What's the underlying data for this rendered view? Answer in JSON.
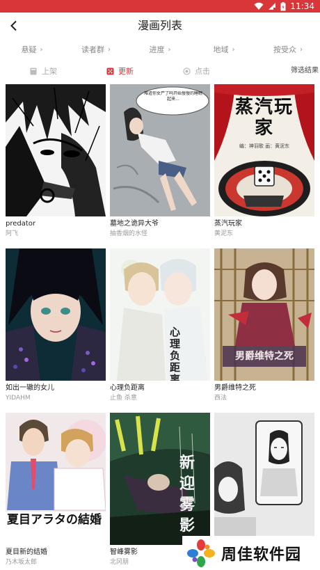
{
  "status_bar": {
    "time": "11:34",
    "color": "#d9363a"
  },
  "header": {
    "title": "漫画列表",
    "back_icon": "chevron-left-icon"
  },
  "filters": [
    {
      "label": "悬疑"
    },
    {
      "label": "读者群"
    },
    {
      "label": "进度"
    },
    {
      "label": "地域"
    },
    {
      "label": "按受众"
    }
  ],
  "sort_tabs": [
    {
      "label": "上架",
      "icon": "shelf-icon",
      "active": false
    },
    {
      "label": "更新",
      "icon": "update-icon",
      "active": true
    },
    {
      "label": "点击",
      "icon": "click-icon",
      "active": false
    }
  ],
  "screen_label": "筛选结果",
  "comics": [
    {
      "title": "predator",
      "author": "阿飞"
    },
    {
      "title": "墓地之诡异大爷",
      "author": "抽香烟的水怪",
      "bubble": "难道你女尸了吗开始慢慢的睡眠起来..."
    },
    {
      "title": "蒸汽玩家",
      "author": "黄泥东",
      "cover_title": "蒸汽玩家",
      "cover_sub": "编：神羽歌  画：黄泥东"
    },
    {
      "title": "如出一辙的女儿",
      "author": "YIDAHM"
    },
    {
      "title": "心理负距离",
      "author": "止鱼 杀意",
      "cover_title": "心理负距离"
    },
    {
      "title": "男爵维特之死",
      "author": "西法",
      "cover_title": "男爵维特之死"
    },
    {
      "title": "夏目新的结婚",
      "author": "乃木坂太郎",
      "cover_title": "夏目アラタの結婚"
    },
    {
      "title": "智峰雾影",
      "author": "北冈朋",
      "cover_title": "新迎雾影"
    },
    {
      "title": "",
      "author": ""
    }
  ],
  "watermark": {
    "text": "周佳软件园"
  }
}
